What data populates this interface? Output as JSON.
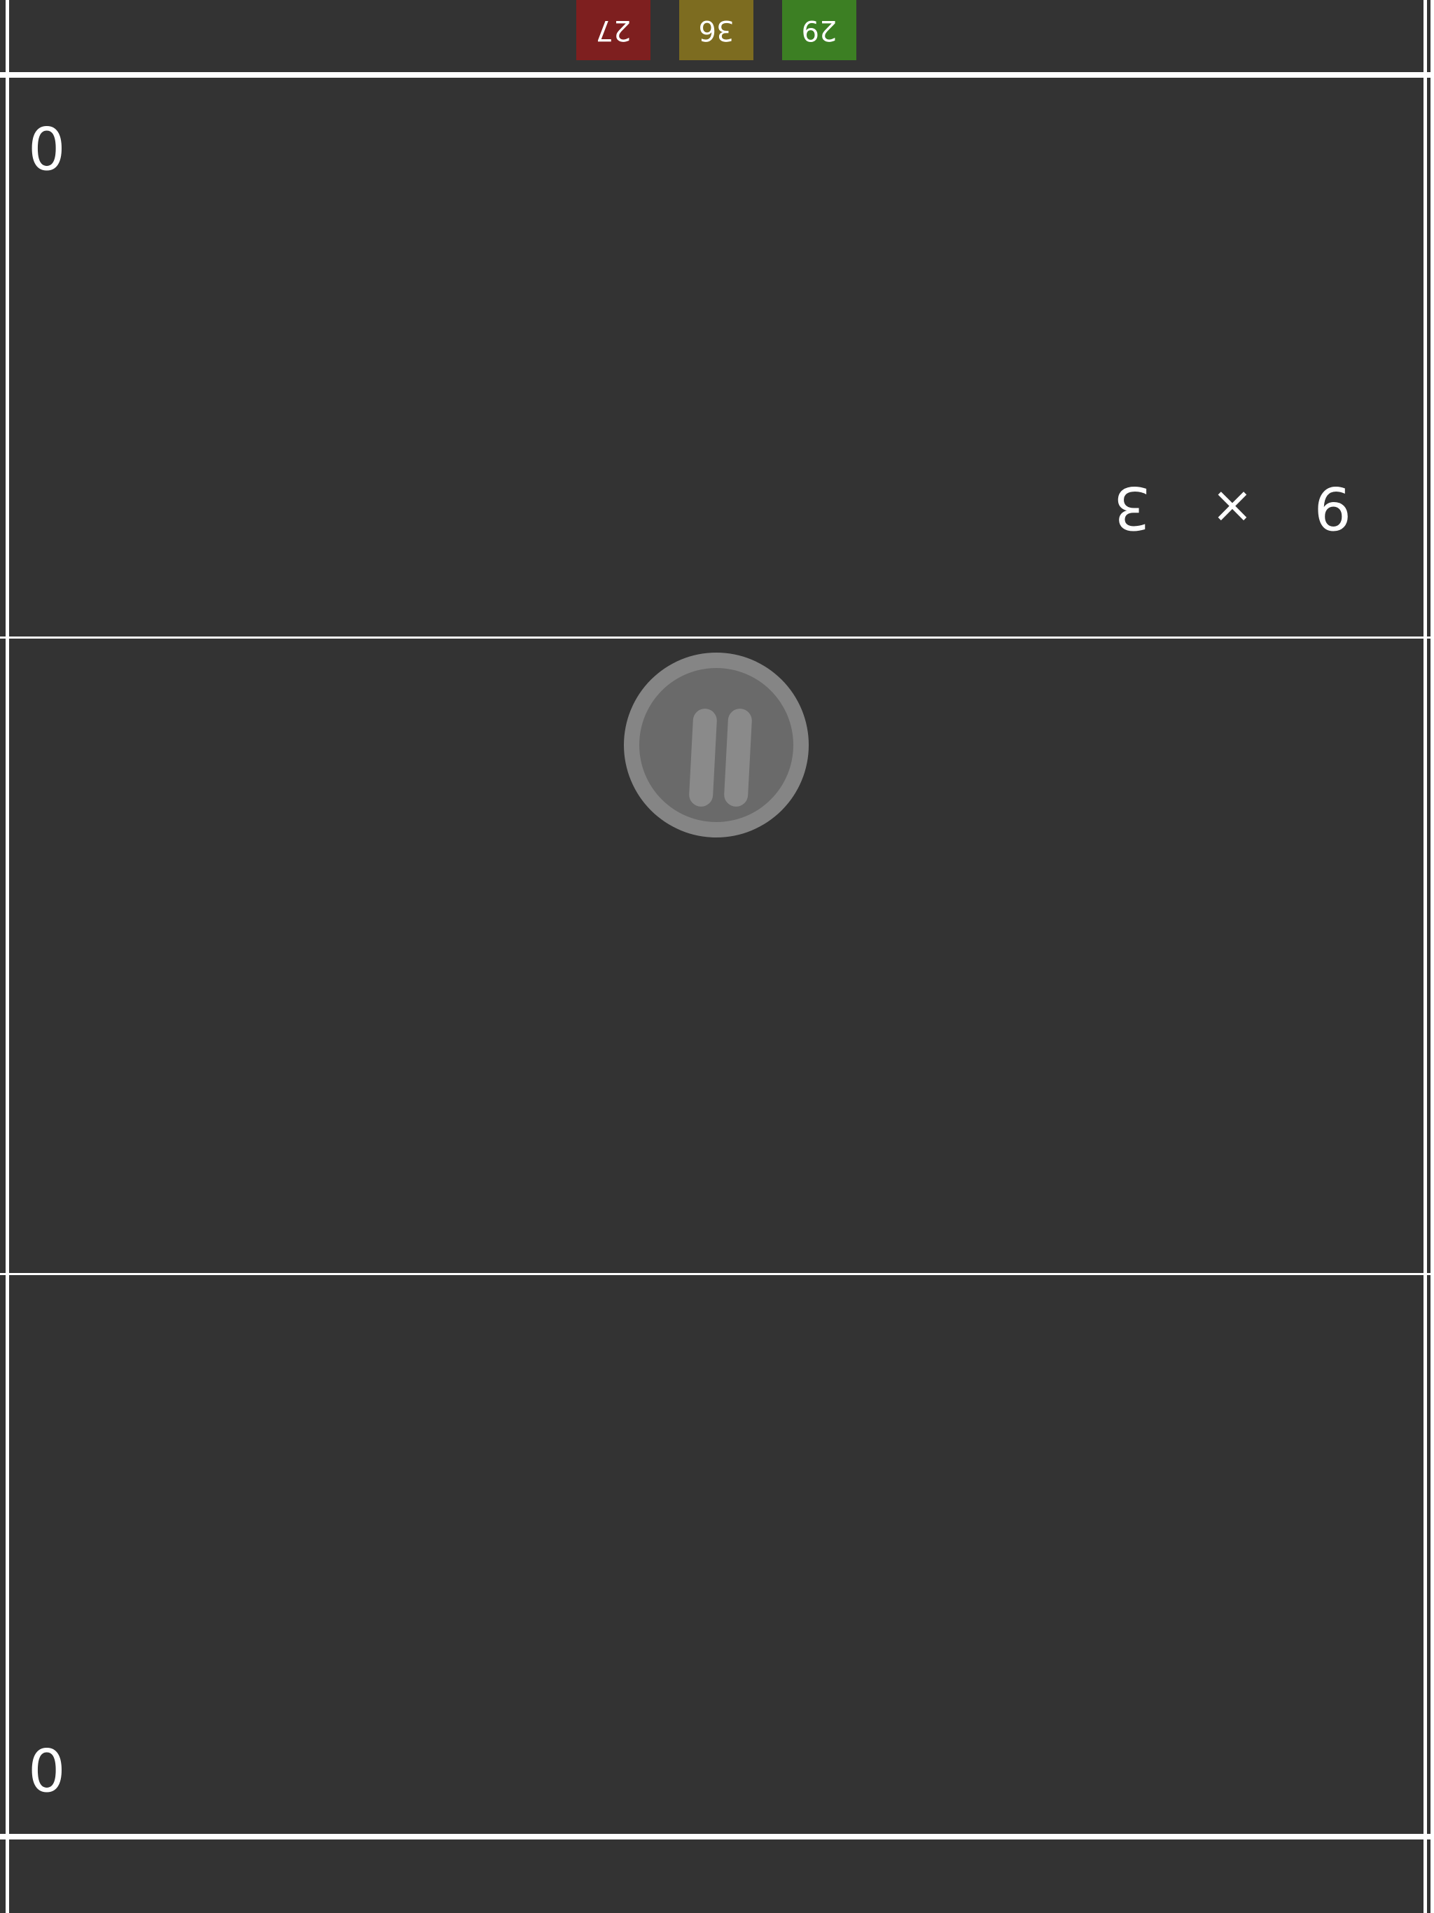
{
  "colors": {
    "background": "#333333",
    "lines": "#ffffff",
    "answer_red": "#7e1f1f",
    "answer_olive": "#7d6c20",
    "answer_green": "#3c7f23",
    "pause_outer": "#858585",
    "pause_inner": "#6a6a6a"
  },
  "top_player": {
    "answers": [
      {
        "value": "27",
        "color": "#7e1f1f"
      },
      {
        "value": "36",
        "color": "#7d6c20"
      },
      {
        "value": "29",
        "color": "#3c7f23"
      }
    ],
    "score": "0",
    "question": {
      "left": "9",
      "operator": "×",
      "right": "3"
    }
  },
  "bottom_player": {
    "score": "0"
  },
  "pause": {
    "icon": "pause-icon"
  }
}
